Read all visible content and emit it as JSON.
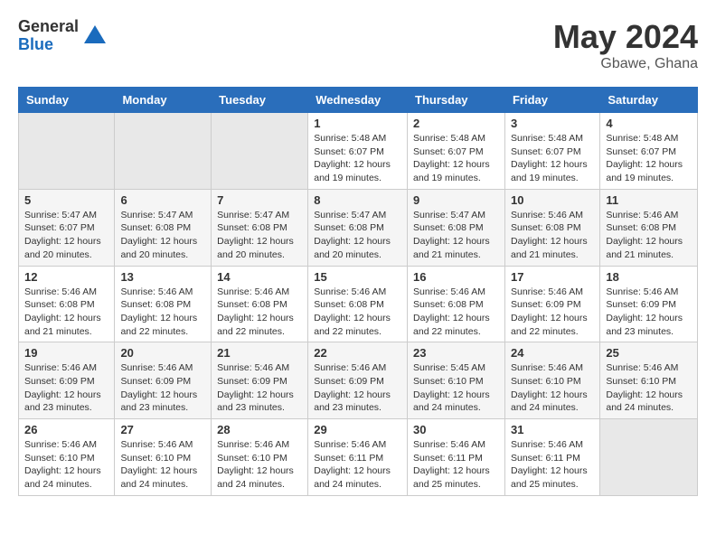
{
  "header": {
    "logo_general": "General",
    "logo_blue": "Blue",
    "title": "May 2024",
    "location": "Gbawe, Ghana"
  },
  "weekdays": [
    "Sunday",
    "Monday",
    "Tuesday",
    "Wednesday",
    "Thursday",
    "Friday",
    "Saturday"
  ],
  "weeks": [
    {
      "days": [
        {
          "num": "",
          "empty": true
        },
        {
          "num": "",
          "empty": true
        },
        {
          "num": "",
          "empty": true
        },
        {
          "num": "1",
          "sunrise": "5:48 AM",
          "sunset": "6:07 PM",
          "daylight": "12 hours and 19 minutes."
        },
        {
          "num": "2",
          "sunrise": "5:48 AM",
          "sunset": "6:07 PM",
          "daylight": "12 hours and 19 minutes."
        },
        {
          "num": "3",
          "sunrise": "5:48 AM",
          "sunset": "6:07 PM",
          "daylight": "12 hours and 19 minutes."
        },
        {
          "num": "4",
          "sunrise": "5:48 AM",
          "sunset": "6:07 PM",
          "daylight": "12 hours and 19 minutes."
        }
      ]
    },
    {
      "days": [
        {
          "num": "5",
          "sunrise": "5:47 AM",
          "sunset": "6:07 PM",
          "daylight": "12 hours and 20 minutes."
        },
        {
          "num": "6",
          "sunrise": "5:47 AM",
          "sunset": "6:08 PM",
          "daylight": "12 hours and 20 minutes."
        },
        {
          "num": "7",
          "sunrise": "5:47 AM",
          "sunset": "6:08 PM",
          "daylight": "12 hours and 20 minutes."
        },
        {
          "num": "8",
          "sunrise": "5:47 AM",
          "sunset": "6:08 PM",
          "daylight": "12 hours and 20 minutes."
        },
        {
          "num": "9",
          "sunrise": "5:47 AM",
          "sunset": "6:08 PM",
          "daylight": "12 hours and 21 minutes."
        },
        {
          "num": "10",
          "sunrise": "5:46 AM",
          "sunset": "6:08 PM",
          "daylight": "12 hours and 21 minutes."
        },
        {
          "num": "11",
          "sunrise": "5:46 AM",
          "sunset": "6:08 PM",
          "daylight": "12 hours and 21 minutes."
        }
      ]
    },
    {
      "days": [
        {
          "num": "12",
          "sunrise": "5:46 AM",
          "sunset": "6:08 PM",
          "daylight": "12 hours and 21 minutes."
        },
        {
          "num": "13",
          "sunrise": "5:46 AM",
          "sunset": "6:08 PM",
          "daylight": "12 hours and 22 minutes."
        },
        {
          "num": "14",
          "sunrise": "5:46 AM",
          "sunset": "6:08 PM",
          "daylight": "12 hours and 22 minutes."
        },
        {
          "num": "15",
          "sunrise": "5:46 AM",
          "sunset": "6:08 PM",
          "daylight": "12 hours and 22 minutes."
        },
        {
          "num": "16",
          "sunrise": "5:46 AM",
          "sunset": "6:08 PM",
          "daylight": "12 hours and 22 minutes."
        },
        {
          "num": "17",
          "sunrise": "5:46 AM",
          "sunset": "6:09 PM",
          "daylight": "12 hours and 22 minutes."
        },
        {
          "num": "18",
          "sunrise": "5:46 AM",
          "sunset": "6:09 PM",
          "daylight": "12 hours and 23 minutes."
        }
      ]
    },
    {
      "days": [
        {
          "num": "19",
          "sunrise": "5:46 AM",
          "sunset": "6:09 PM",
          "daylight": "12 hours and 23 minutes."
        },
        {
          "num": "20",
          "sunrise": "5:46 AM",
          "sunset": "6:09 PM",
          "daylight": "12 hours and 23 minutes."
        },
        {
          "num": "21",
          "sunrise": "5:46 AM",
          "sunset": "6:09 PM",
          "daylight": "12 hours and 23 minutes."
        },
        {
          "num": "22",
          "sunrise": "5:46 AM",
          "sunset": "6:09 PM",
          "daylight": "12 hours and 23 minutes."
        },
        {
          "num": "23",
          "sunrise": "5:45 AM",
          "sunset": "6:10 PM",
          "daylight": "12 hours and 24 minutes."
        },
        {
          "num": "24",
          "sunrise": "5:46 AM",
          "sunset": "6:10 PM",
          "daylight": "12 hours and 24 minutes."
        },
        {
          "num": "25",
          "sunrise": "5:46 AM",
          "sunset": "6:10 PM",
          "daylight": "12 hours and 24 minutes."
        }
      ]
    },
    {
      "days": [
        {
          "num": "26",
          "sunrise": "5:46 AM",
          "sunset": "6:10 PM",
          "daylight": "12 hours and 24 minutes."
        },
        {
          "num": "27",
          "sunrise": "5:46 AM",
          "sunset": "6:10 PM",
          "daylight": "12 hours and 24 minutes."
        },
        {
          "num": "28",
          "sunrise": "5:46 AM",
          "sunset": "6:10 PM",
          "daylight": "12 hours and 24 minutes."
        },
        {
          "num": "29",
          "sunrise": "5:46 AM",
          "sunset": "6:11 PM",
          "daylight": "12 hours and 24 minutes."
        },
        {
          "num": "30",
          "sunrise": "5:46 AM",
          "sunset": "6:11 PM",
          "daylight": "12 hours and 25 minutes."
        },
        {
          "num": "31",
          "sunrise": "5:46 AM",
          "sunset": "6:11 PM",
          "daylight": "12 hours and 25 minutes."
        },
        {
          "num": "",
          "empty": true
        }
      ]
    }
  ],
  "labels": {
    "sunrise": "Sunrise:",
    "sunset": "Sunset:",
    "daylight": "Daylight:"
  }
}
